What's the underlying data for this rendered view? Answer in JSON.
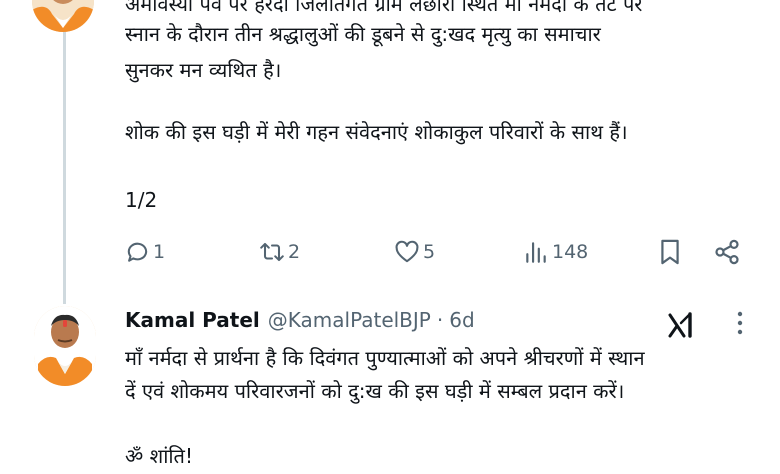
{
  "first_tweet": {
    "line_partial": "अमावस्या पर्व पर हरदा जिलांतर्गत ग्राम लछोरा स्थित माँ नर्मदा के तट पर",
    "line_1": "स्नान के दौरान तीन श्रद्धालुओं की डूबने से दु:खद मृत्यु का समाचार",
    "line_2": "सुनकर मन व्यथित है।",
    "line_3": "शोक की इस घड़ी में मेरी गहन संवेदनाएं शोकाकुल परिवारों के साथ हैं।",
    "line_4": "1/2",
    "reply_count": "1",
    "retweet_count": "2",
    "like_count": "5",
    "view_count": "148"
  },
  "second_tweet": {
    "author_name": "Kamal Patel",
    "author_handle": "@KamalPatelBJP",
    "separator": "·",
    "time": "6d",
    "line_1": "माँ नर्मदा से प्रार्थना है कि दिवंगत पुण्यात्माओं को अपने श्रीचरणों में स्थान",
    "line_2": "दें एवं शोकमय परिवारजनों को दु:ख की इस घड़ी में सम्बल प्रदान करें।",
    "line_3": "ॐ शांति!"
  },
  "colors": {
    "text": "#0f1419",
    "secondary": "#536471",
    "thread_line": "#cfd9de",
    "saffron": "#f28c28"
  },
  "icons": [
    "reply-icon",
    "retweet-icon",
    "like-icon",
    "views-icon",
    "bookmark-icon",
    "share-icon",
    "grok-icon",
    "more-icon"
  ]
}
